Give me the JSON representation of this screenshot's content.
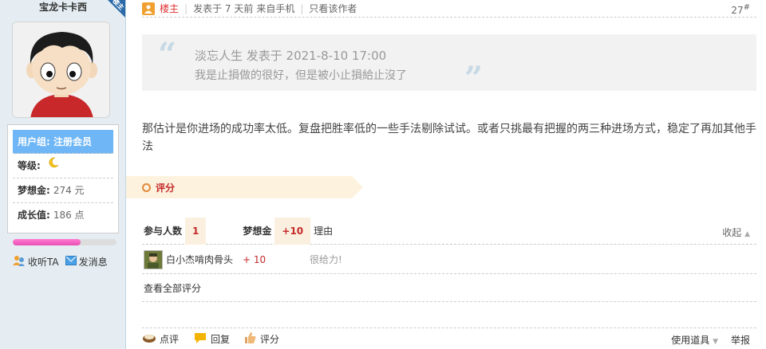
{
  "sidebar": {
    "username": "宝龙卡卡西",
    "corner_badge": "楼主",
    "group_label": "用户组:",
    "group_value": "注册会员",
    "level_label": "等级:",
    "points_label": "梦想金:",
    "points_value": "274 元",
    "growth_label": "成长值:",
    "growth_value": "186 点",
    "progress_fraction": 0.65,
    "follow_label": "收听TA",
    "message_label": "发消息"
  },
  "post": {
    "lz_label": "楼主",
    "posted_text": "发表于 7 天前",
    "source_text": "来自手机",
    "only_author": "只看该作者",
    "floor": "27",
    "floor_sup": "#",
    "quote_author": "淡忘人生 发表于 2021-8-10 17:00",
    "quote_text": "我是止損做的很好，但是被小止損給止沒了",
    "body": "那估计是你进场的成功率太低。复盘把胜率低的一些手法剔除试试。或者只挑最有把握的两三种进场方式，稳定了再加其他手法"
  },
  "rating": {
    "tag_label": "评分",
    "participants_label": "参与人数",
    "participants_value": "1",
    "points_label": "梦想金",
    "points_value": "+10",
    "reason_label": "理由",
    "collapse_label": "收起",
    "rows": [
      {
        "name": "白小杰啃肉骨头",
        "score": "+ 10",
        "reason": "很给力!"
      }
    ],
    "view_all": "查看全部评分"
  },
  "actions": {
    "comment": "点评",
    "reply": "回复",
    "rate": "评分",
    "use_tool": "使用道具",
    "report": "举报"
  },
  "colors": {
    "group_bg": "#6eb6f5",
    "accent_red": "#c42b2b",
    "sidebar_bg": "#e5edf2"
  }
}
